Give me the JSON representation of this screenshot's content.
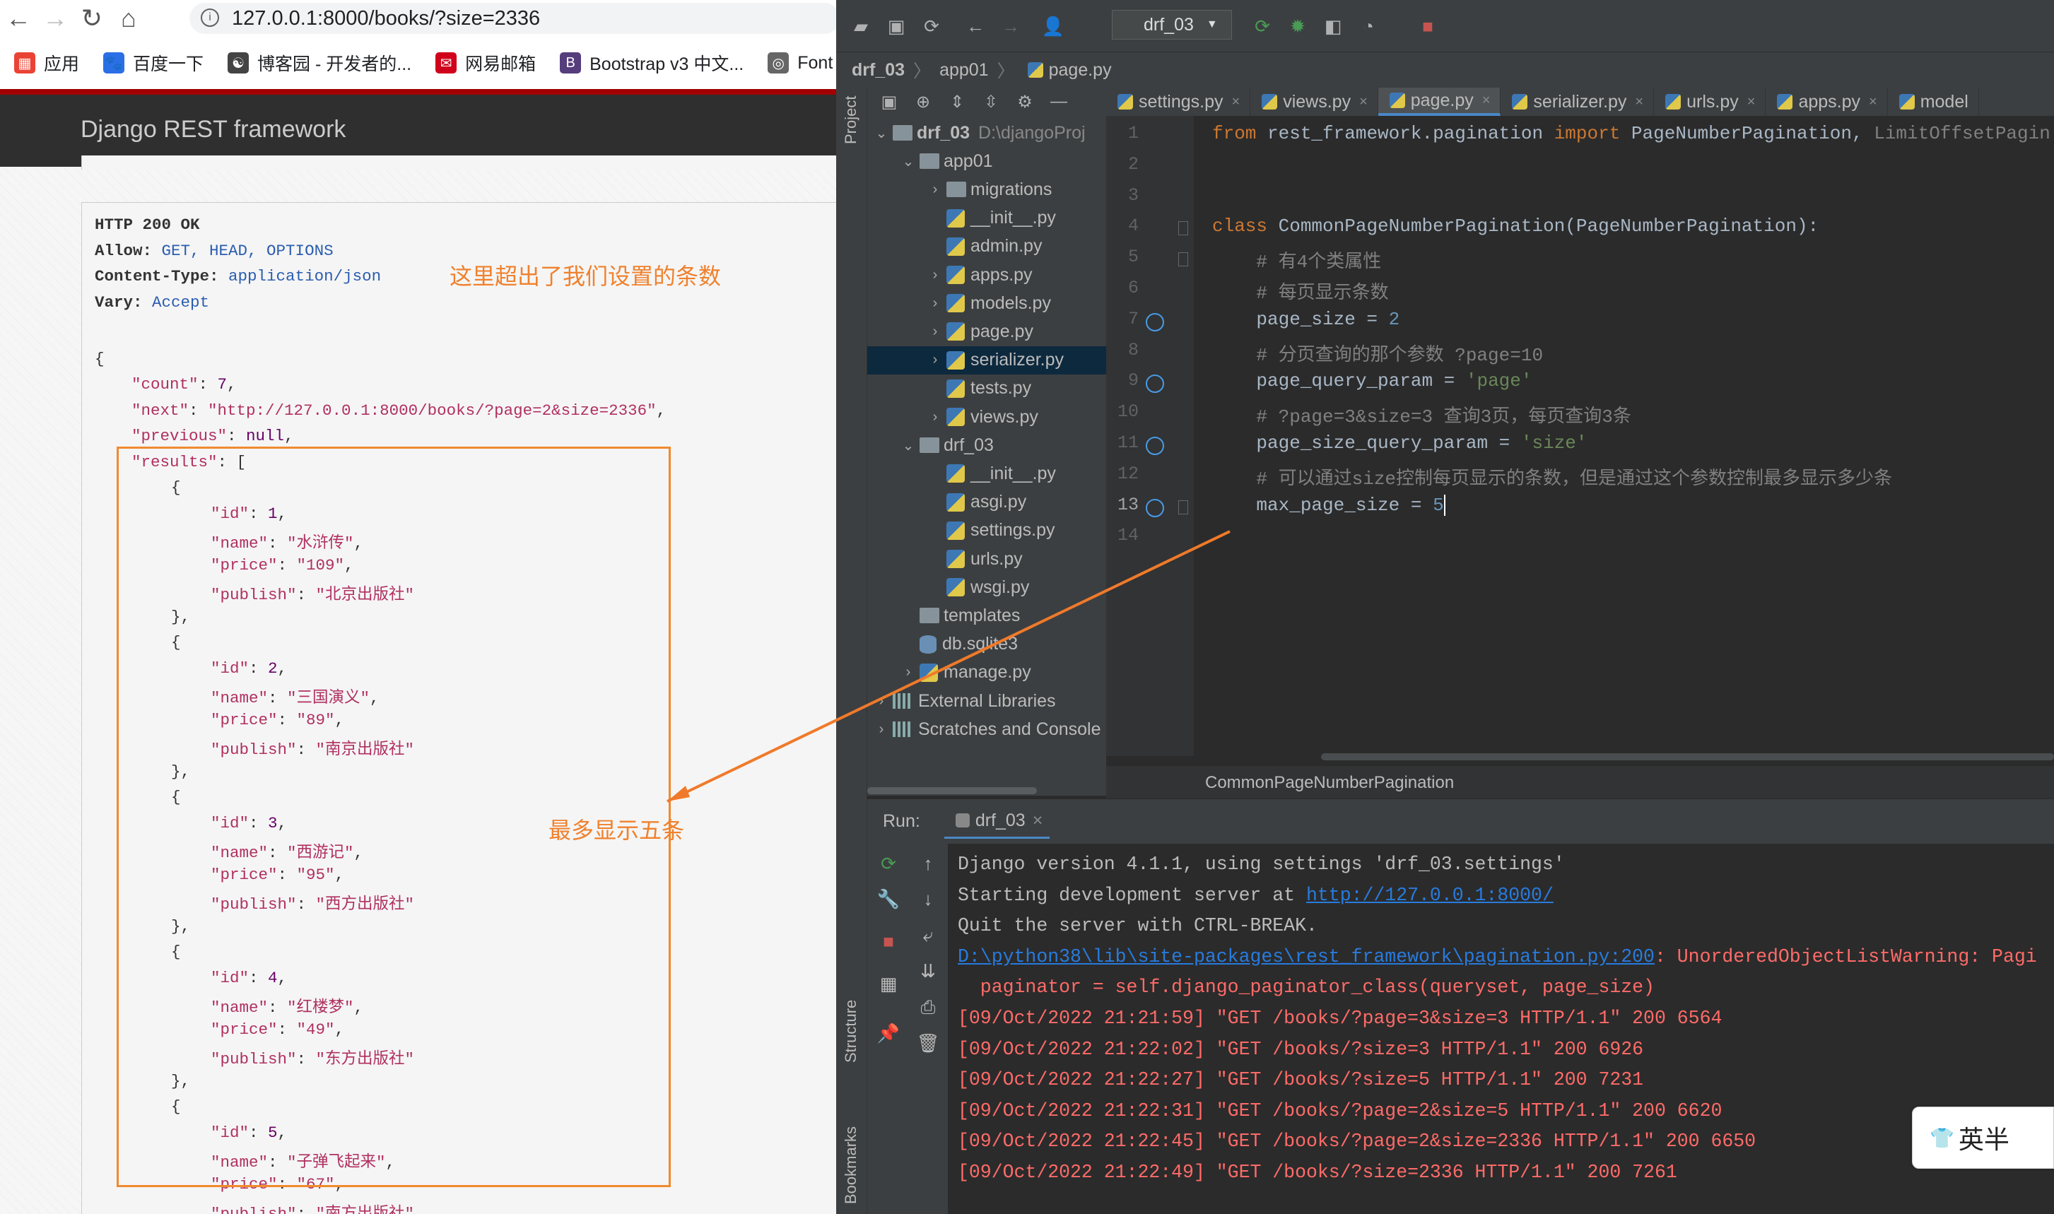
{
  "browser": {
    "url": "127.0.0.1:8000/books/?size=2336",
    "bookmarks": [
      "应用",
      "百度一下",
      "博客园 - 开发者的...",
      "网易邮箱",
      "Bootstrap v3 中文...",
      "Font"
    ],
    "drf_title": "Django REST framework"
  },
  "response": {
    "status_line": "HTTP 200 OK",
    "headers": [
      {
        "key": "Allow:",
        "value": "GET, HEAD, OPTIONS"
      },
      {
        "key": "Content-Type:",
        "value": "application/json"
      },
      {
        "key": "Vary:",
        "value": "Accept"
      }
    ],
    "count": "7",
    "next": "\"http://127.0.0.1:8000/books/?page=2&size=2336\"",
    "previous": "null",
    "results": [
      {
        "id": "1",
        "name": "\"水浒传\"",
        "price": "\"109\"",
        "publish": "\"北京出版社\""
      },
      {
        "id": "2",
        "name": "\"三国演义\"",
        "price": "\"89\"",
        "publish": "\"南京出版社\""
      },
      {
        "id": "3",
        "name": "\"西游记\"",
        "price": "\"95\"",
        "publish": "\"西方出版社\""
      },
      {
        "id": "4",
        "name": "\"红楼梦\"",
        "price": "\"49\"",
        "publish": "\"东方出版社\""
      },
      {
        "id": "5",
        "name": "\"子弹飞起来\"",
        "price": "\"67\"",
        "publish": "\"南方出版社\""
      }
    ]
  },
  "annotations": {
    "exceeded": "这里超出了我们设置的条数",
    "max_five": "最多显示五条"
  },
  "ide": {
    "run_config": "drf_03",
    "breadcrumbs": [
      "drf_03",
      "app01",
      "page.py"
    ],
    "side_labels": {
      "project": "Project",
      "structure": "Structure",
      "bookmarks": "Bookmarks"
    },
    "tabs": [
      "settings.py",
      "views.py",
      "page.py",
      "serializer.py",
      "urls.py",
      "apps.py",
      "model"
    ],
    "active_tab": "page.py",
    "tree": [
      {
        "label": "drf_03",
        "extra": "D:\\djangoProj",
        "type": "folder",
        "depth": 0,
        "arrow": "v"
      },
      {
        "label": "app01",
        "type": "folder",
        "depth": 1,
        "arrow": "v"
      },
      {
        "label": "migrations",
        "type": "folder",
        "depth": 2,
        "arrow": ">"
      },
      {
        "label": "__init__.py",
        "type": "py",
        "depth": 2,
        "arrow": ""
      },
      {
        "label": "admin.py",
        "type": "py",
        "depth": 2,
        "arrow": ""
      },
      {
        "label": "apps.py",
        "type": "py",
        "depth": 2,
        "arrow": ">"
      },
      {
        "label": "models.py",
        "type": "py",
        "depth": 2,
        "arrow": ">"
      },
      {
        "label": "page.py",
        "type": "py",
        "depth": 2,
        "arrow": ">"
      },
      {
        "label": "serializer.py",
        "type": "py",
        "depth": 2,
        "arrow": ">",
        "selected": true
      },
      {
        "label": "tests.py",
        "type": "py",
        "depth": 2,
        "arrow": ""
      },
      {
        "label": "views.py",
        "type": "py",
        "depth": 2,
        "arrow": ">"
      },
      {
        "label": "drf_03",
        "type": "folder",
        "depth": 1,
        "arrow": "v"
      },
      {
        "label": "__init__.py",
        "type": "py",
        "depth": 2,
        "arrow": ""
      },
      {
        "label": "asgi.py",
        "type": "py",
        "depth": 2,
        "arrow": ""
      },
      {
        "label": "settings.py",
        "type": "py",
        "depth": 2,
        "arrow": ""
      },
      {
        "label": "urls.py",
        "type": "py",
        "depth": 2,
        "arrow": ""
      },
      {
        "label": "wsgi.py",
        "type": "py",
        "depth": 2,
        "arrow": ""
      },
      {
        "label": "templates",
        "type": "folder",
        "depth": 1,
        "arrow": ""
      },
      {
        "label": "db.sqlite3",
        "type": "db",
        "depth": 1,
        "arrow": ""
      },
      {
        "label": "manage.py",
        "type": "py",
        "depth": 1,
        "arrow": ">"
      },
      {
        "label": "External Libraries",
        "type": "lib",
        "depth": 0,
        "arrow": ">"
      },
      {
        "label": "Scratches and Console",
        "type": "lib",
        "depth": 0,
        "arrow": ">"
      }
    ],
    "code_lines": [
      {
        "n": "1",
        "html": "<span class=\"kw\">from</span> rest_framework.pagination <span class=\"kw\">import</span> PageNumberPagination, <span class=\"cm\">LimitOffsetPagin</span>"
      },
      {
        "n": "2",
        "html": ""
      },
      {
        "n": "3",
        "html": ""
      },
      {
        "n": "4",
        "html": "<span class=\"kw\">class</span> CommonPageNumberPagination(PageNumberPagination):"
      },
      {
        "n": "5",
        "html": "    <span class=\"cm\"># 有4个类属性</span>"
      },
      {
        "n": "6",
        "html": "    <span class=\"cm\"># 每页显示条数</span>"
      },
      {
        "n": "7",
        "html": "    page_size = <span class=\"nm\">2</span>"
      },
      {
        "n": "8",
        "html": "    <span class=\"cm\"># 分页查询的那个参数 ?page=10</span>"
      },
      {
        "n": "9",
        "html": "    page_query_param = <span class=\"st\">'page'</span>"
      },
      {
        "n": "10",
        "html": "    <span class=\"cm\"># ?page=3&amp;size=3 查询3页，每页查询3条</span>"
      },
      {
        "n": "11",
        "html": "    page_size_query_param = <span class=\"st\">'size'</span>"
      },
      {
        "n": "12",
        "html": "    <span class=\"cm\"># 可以通过size控制每页显示的条数，但是通过这个参数控制最多显示多少条</span>"
      },
      {
        "n": "13",
        "html": "    max_page_size = <span class=\"nm\">5</span><span class=\"caret\"></span>"
      },
      {
        "n": "14",
        "html": ""
      }
    ],
    "marked_lines": [
      "7",
      "9",
      "11",
      "13"
    ],
    "structure_crumb": "CommonPageNumberPagination",
    "run_label": "Run:",
    "run_tab": "drf_03",
    "console": [
      {
        "text": "Django version 4.1.1, using settings 'drf_03.settings'",
        "style": "cw"
      },
      {
        "text": "Starting development server at ",
        "link": "http://127.0.0.1:8000/",
        "style": "cw"
      },
      {
        "text": "Quit the server with CTRL-BREAK.",
        "style": "cw"
      },
      {
        "link": "D:\\python38\\lib\\site-packages\\rest_framework\\pagination.py:200",
        "text2": ": UnorderedObjectListWarning: Pagi",
        "style": "cr"
      },
      {
        "text": "  paginator = self.django_paginator_class(queryset, page_size)",
        "style": "cr"
      },
      {
        "text": "[09/Oct/2022 21:21:59] \"GET /books/?page=3&size=3 HTTP/1.1\" 200 6564",
        "style": "cr"
      },
      {
        "text": "[09/Oct/2022 21:22:02] \"GET /books/?size=3 HTTP/1.1\" 200 6926",
        "style": "cr"
      },
      {
        "text": "[09/Oct/2022 21:22:27] \"GET /books/?size=5 HTTP/1.1\" 200 7231",
        "style": "cr"
      },
      {
        "text": "[09/Oct/2022 21:22:31] \"GET /books/?page=2&size=5 HTTP/1.1\" 200 6620",
        "style": "cr"
      },
      {
        "text": "[09/Oct/2022 21:22:45] \"GET /books/?page=2&size=2336 HTTP/1.1\" 200 6650",
        "style": "cr"
      },
      {
        "text": "[09/Oct/2022 21:22:49] \"GET /books/?size=2336 HTTP/1.1\" 200 7261",
        "style": "cr"
      }
    ],
    "ime": "英半"
  }
}
